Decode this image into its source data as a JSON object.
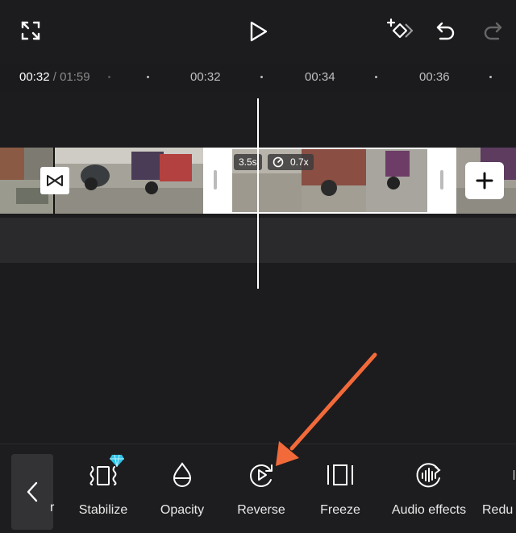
{
  "timeline": {
    "current_time": "00:32",
    "total_time": "01:59",
    "separator": "/",
    "ticks": [
      "00:32",
      "00:34",
      "00:36"
    ]
  },
  "clip": {
    "duration_badge": "3.5s",
    "speed_badge": "0.7x"
  },
  "toolbar": {
    "partial_left_label": "r",
    "items": [
      {
        "label": "Stabilize",
        "icon": "stabilize-icon",
        "premium": true
      },
      {
        "label": "Opacity",
        "icon": "opacity-icon"
      },
      {
        "label": "Reverse",
        "icon": "reverse-icon"
      },
      {
        "label": "Freeze",
        "icon": "freeze-icon"
      },
      {
        "label": "Audio effects",
        "icon": "audio-effects-icon"
      },
      {
        "label": "Redu",
        "icon": "reduce-icon"
      }
    ]
  },
  "colors": {
    "background": "#1c1c1e",
    "annotation_arrow": "#f26a3a",
    "premium_badge": "#2ec4e8"
  }
}
